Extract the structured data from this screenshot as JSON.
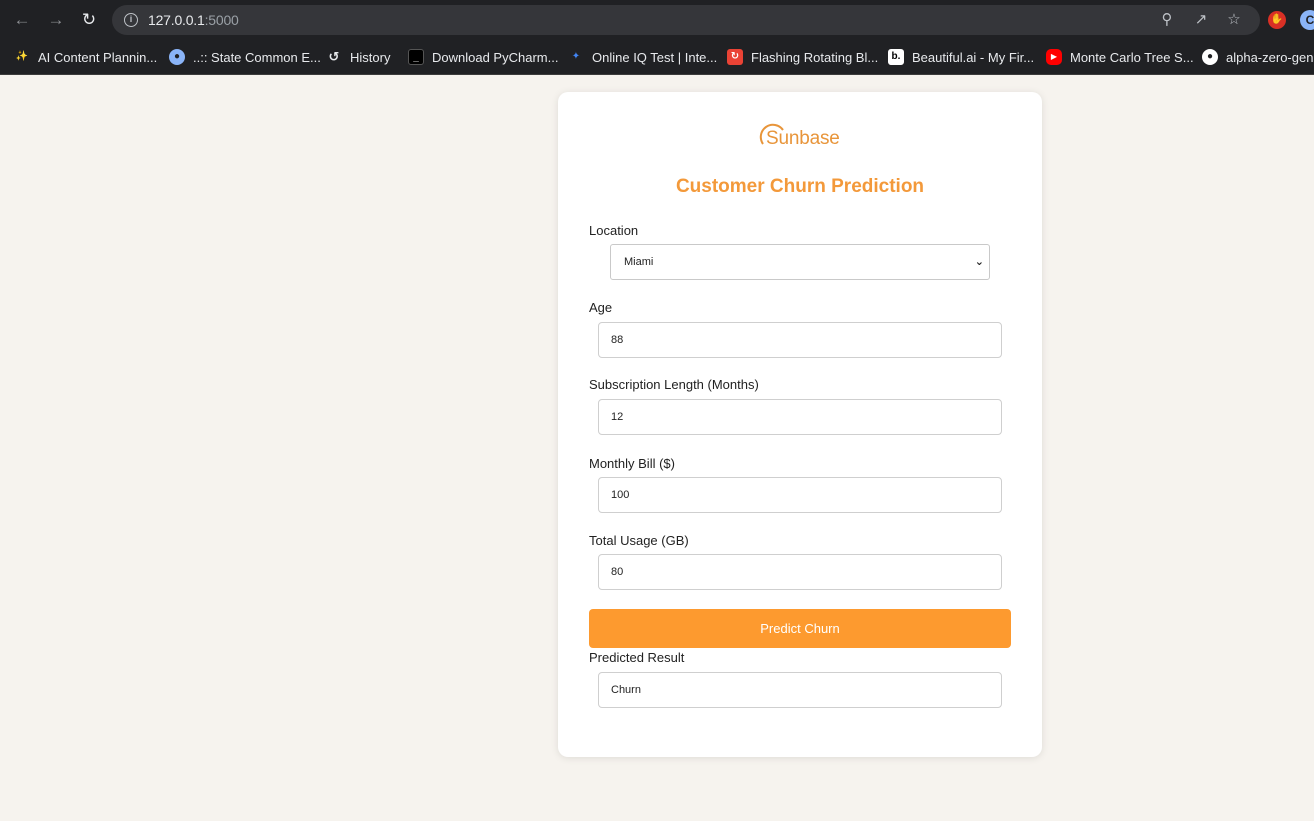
{
  "browser": {
    "url_host": "127.0.0.1",
    "url_port": ":5000",
    "bookmarks": [
      {
        "label": "AI Content Plannin...",
        "icon": "sparkle-icon",
        "color": "#f4b400"
      },
      {
        "label": "..:: State Common E...",
        "icon": "globe-icon",
        "color": "#8ab4f8"
      },
      {
        "label": "History",
        "icon": "history-icon",
        "color": "#e8eaed"
      },
      {
        "label": "Download PyCharm...",
        "icon": "pycharm-icon",
        "color": "#000000"
      },
      {
        "label": "Online IQ Test | Inte...",
        "icon": "iq-test-icon",
        "color": "#4285f4"
      },
      {
        "label": "Flashing Rotating Bl...",
        "icon": "flashing-icon",
        "color": "#ea4335"
      },
      {
        "label": "Beautiful.ai - My Fir...",
        "icon": "beautiful-ai-icon",
        "color": "#ffffff"
      },
      {
        "label": "Monte Carlo Tree S...",
        "icon": "youtube-icon",
        "color": "#ff0000"
      },
      {
        "label": "alpha-zero-gene",
        "icon": "github-icon",
        "color": "#ffffff"
      }
    ]
  },
  "app": {
    "logo_text": "Sunbase",
    "title": "Customer Churn Prediction",
    "accent_color": "#f3993a",
    "fields": {
      "location": {
        "label": "Location",
        "value": "Miami"
      },
      "age": {
        "label": "Age",
        "value": "88"
      },
      "subscription": {
        "label": "Subscription Length (Months)",
        "value": "12"
      },
      "monthly_bill": {
        "label": "Monthly Bill ($)",
        "value": "100"
      },
      "total_usage": {
        "label": "Total Usage (GB)",
        "value": "80"
      }
    },
    "predict_button": "Predict Churn",
    "result": {
      "label": "Predicted Result",
      "value": "Churn"
    }
  }
}
